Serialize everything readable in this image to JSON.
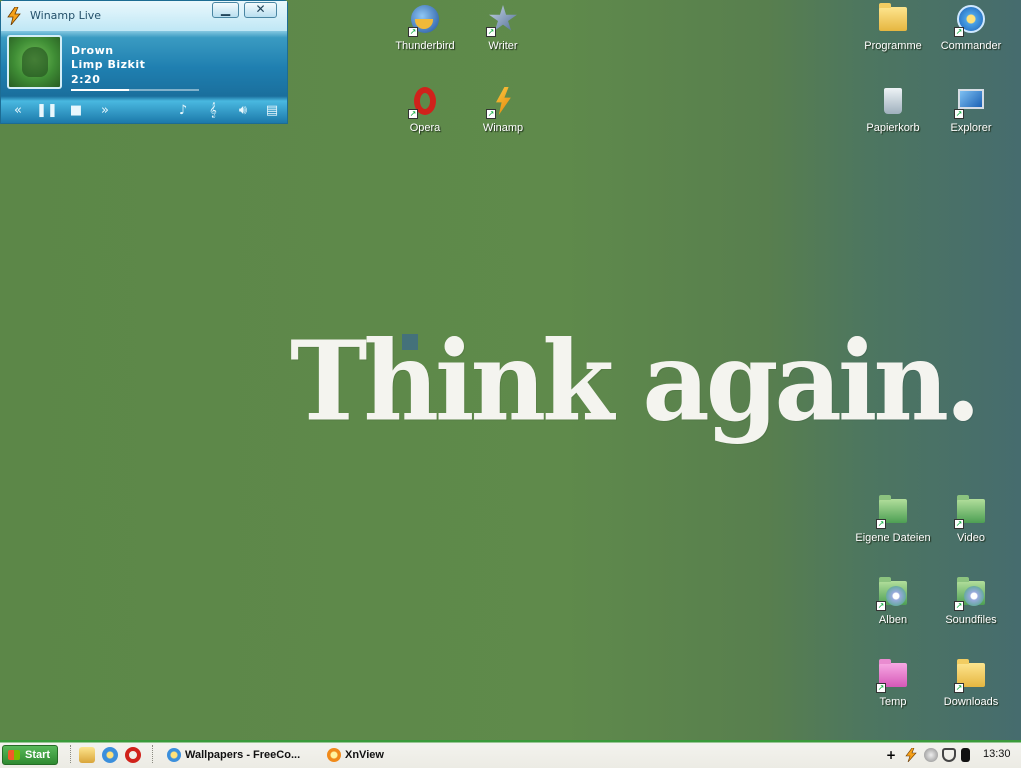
{
  "wallpaper": {
    "text": "Think again."
  },
  "winamp": {
    "title": "Winamp Live",
    "track_title": "Drown",
    "artist": "Limp Bizkit",
    "time": "2:20",
    "progress": 0.45,
    "controls": [
      "previous-icon",
      "pause-icon",
      "stop-icon",
      "next-icon",
      "music-note-icon",
      "treble-clef-icon",
      "volume-icon",
      "playlist-icon"
    ]
  },
  "desktop_icons": [
    {
      "label": "Thunderbird"
    },
    {
      "label": "Writer"
    },
    {
      "label": "Opera"
    },
    {
      "label": "Winamp"
    },
    {
      "label": "Programme"
    },
    {
      "label": "Commander"
    },
    {
      "label": "Papierkorb"
    },
    {
      "label": "Explorer"
    },
    {
      "label": "Eigene Dateien"
    },
    {
      "label": "Video"
    },
    {
      "label": "Alben"
    },
    {
      "label": "Soundfiles"
    },
    {
      "label": "Temp"
    },
    {
      "label": "Downloads"
    }
  ],
  "taskbar": {
    "start_label": "Start",
    "tasks": [
      {
        "label": "Wallpapers - FreeCo..."
      },
      {
        "label": "XnView"
      }
    ],
    "clock": "13:30"
  },
  "colors": {
    "desktop_green": "#5f8a4b",
    "taskbar_green": "#3a9a3b",
    "winamp_blue": "#1f7fb0"
  }
}
